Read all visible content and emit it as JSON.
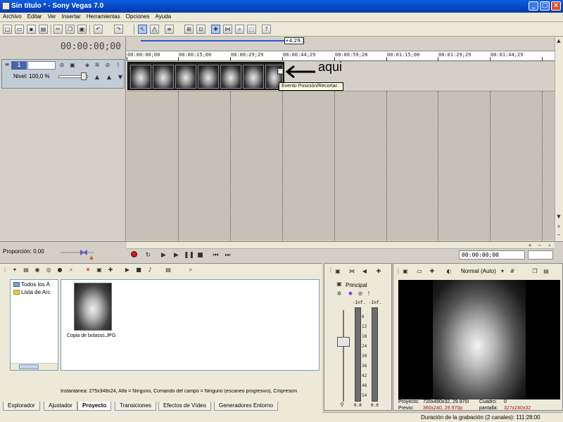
{
  "window": {
    "title": "Sin título * - Sony Vegas 7.0",
    "min": "_",
    "max": "□",
    "close": "×"
  },
  "menu": [
    "Archivo",
    "Editar",
    "Ver",
    "Insertar",
    "Herramientas",
    "Opciones",
    "Ayuda"
  ],
  "timeline": {
    "timecode": "00:00:00;00",
    "cursor_label": "+4:29:1",
    "ruler_ticks": [
      "00:00:00;00",
      "00:00:15;00",
      "00:00:29;29",
      "00:00:44;29",
      "00:00:59;28",
      "00:01:15;00",
      "00:01:29;29",
      "00:01:44;29"
    ],
    "track_number": "1",
    "level_label": "Nivel: 100,0 %",
    "annotation": "aqui",
    "tooltip": "Evento Posición/Recortar..."
  },
  "transport": {
    "ratio_label": "Proporción: 0.00",
    "timecode": "00:00:00;00"
  },
  "explorer": {
    "tree_items": [
      "Todos los A",
      "Lista de Arc"
    ],
    "media_label": "Copia de bolasss.JPG",
    "media_info": "Instantánea: 275x348x24, Alfa = Ninguno, Comando del campo = Ninguno (escaneo progresivo), Cmpresión",
    "tabs": [
      "Explorador",
      "Ajustador",
      "Proyecto",
      "Transiciones",
      "Efectos de Vídeo",
      "Generadores Entorno"
    ]
  },
  "mixer": {
    "label": "Principal",
    "inf_left": "-Inf.",
    "inf_right": "-Inf.",
    "scale": [
      "6",
      "12",
      "18",
      "24",
      "30",
      "36",
      "42",
      "48",
      "54"
    ],
    "zero_left": "0.0",
    "zero_right": "0.0"
  },
  "preview": {
    "quality": "Normal (Auto)",
    "proyecto_label": "Proyecto:",
    "proyecto_value": "720x480x32, 29.970i",
    "previo_label": "Previo:",
    "previo_value": "360x240, 29.970p",
    "cuadro_label": "Cuadro:",
    "cuadro_value": "0",
    "pantalla_label": "pantalla:",
    "pantalla_value": "327x240x32"
  },
  "status": {
    "text": "Duración de la grabación (2 canales): 111:28:00"
  }
}
